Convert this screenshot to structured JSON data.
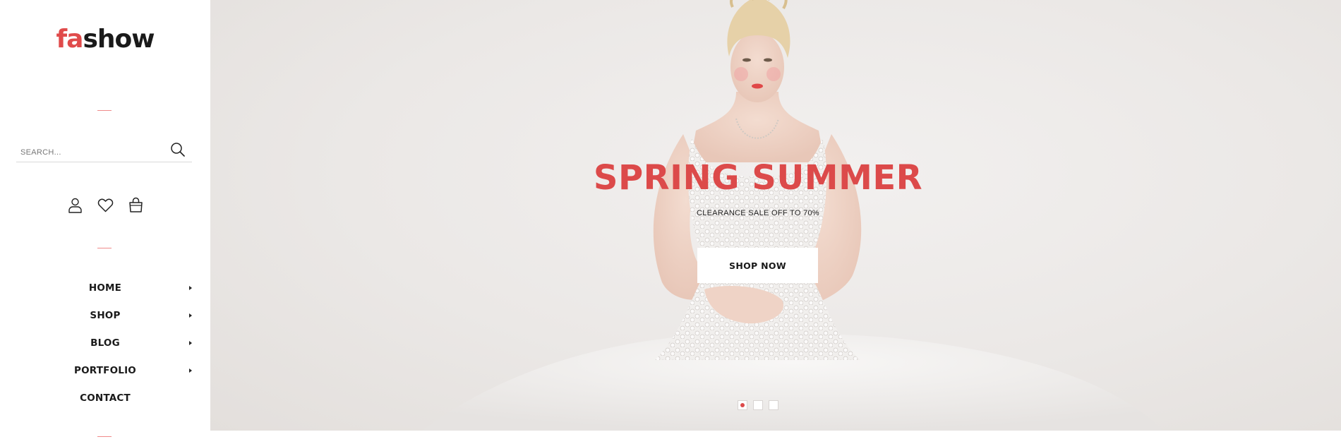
{
  "brand": {
    "logo_accent": "fa",
    "logo_rest": "show",
    "accent_color": "#e04b4b"
  },
  "search": {
    "placeholder": "SEARCH..."
  },
  "user_icons": [
    "user-icon",
    "heart-icon",
    "shopping-bag-icon"
  ],
  "nav": {
    "items": [
      {
        "label": "HOME",
        "has_submenu": true
      },
      {
        "label": "SHOP",
        "has_submenu": true
      },
      {
        "label": "BLOG",
        "has_submenu": true
      },
      {
        "label": "PORTFOLIO",
        "has_submenu": true
      },
      {
        "label": "CONTACT",
        "has_submenu": false
      }
    ]
  },
  "hero": {
    "title": "SPRING SUMMER",
    "subtitle": "CLEARANCE SALE OFF TO 70%",
    "button_label": "SHOP NOW",
    "title_color": "#dc4a4a",
    "slides_count": 3,
    "active_slide": 1
  }
}
